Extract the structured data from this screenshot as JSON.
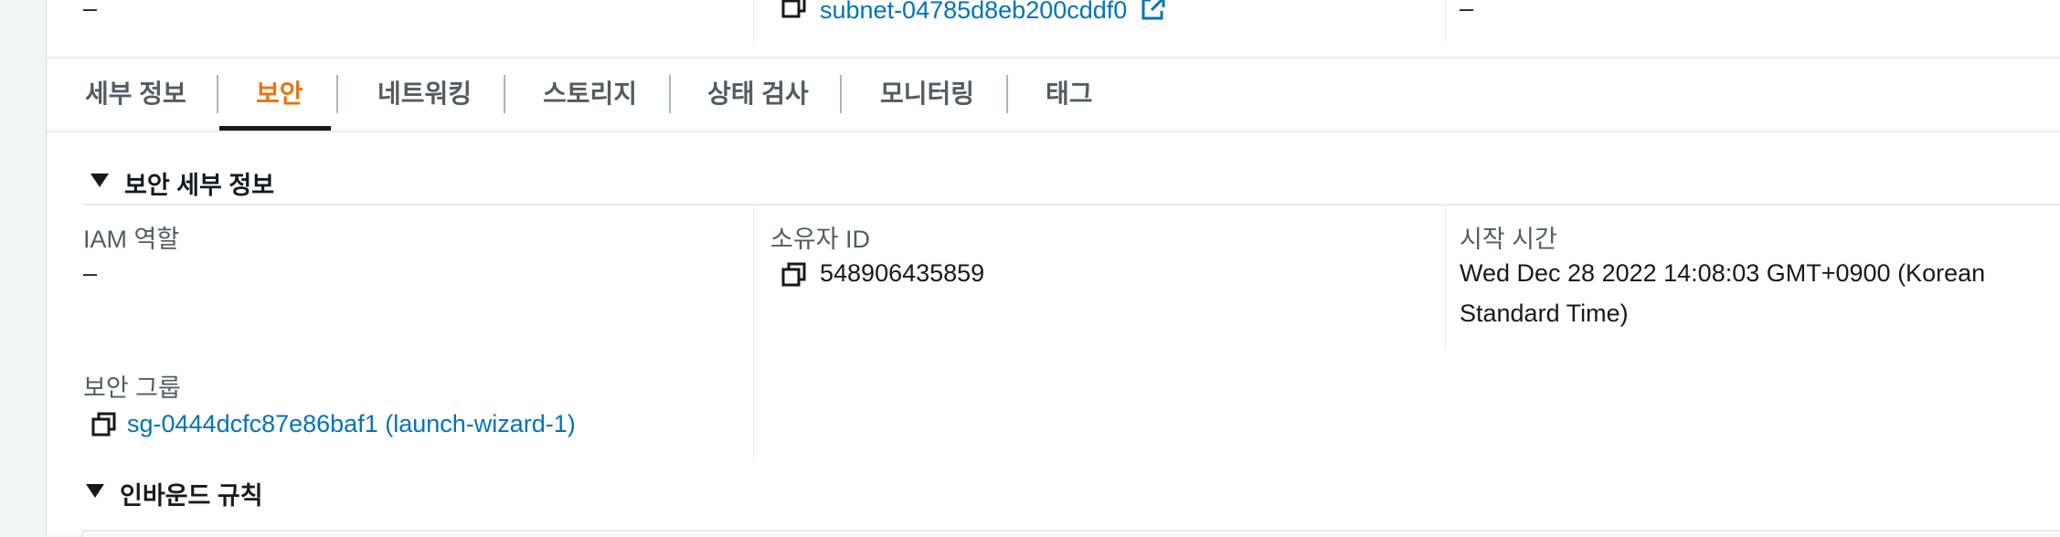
{
  "top_row": {
    "col1_value": "–",
    "subnet_link": "subnet-04785d8eb200cddf0",
    "col3_value": "–"
  },
  "tabs": [
    {
      "label": "세부 정보"
    },
    {
      "label": "보안"
    },
    {
      "label": "네트워킹"
    },
    {
      "label": "스토리지"
    },
    {
      "label": "상태 검사"
    },
    {
      "label": "모니터링"
    },
    {
      "label": "태그"
    }
  ],
  "security_details": {
    "heading": "보안 세부 정보",
    "iam_role": {
      "label": "IAM 역할",
      "value": "–"
    },
    "owner_id": {
      "label": "소유자 ID",
      "value": "548906435859"
    },
    "launch_time": {
      "label": "시작 시간",
      "value_line1": "Wed Dec 28 2022 14:08:03 GMT+0900 (Korean",
      "value_line2": "Standard Time)"
    },
    "security_groups": {
      "label": "보안 그룹",
      "value": "sg-0444dcfc87e86baf1 (launch-wizard-1)"
    }
  },
  "inbound_rules": {
    "heading": "인바운드 규칙"
  },
  "colors": {
    "accent": "#ec7211",
    "link": "#0073bb"
  }
}
